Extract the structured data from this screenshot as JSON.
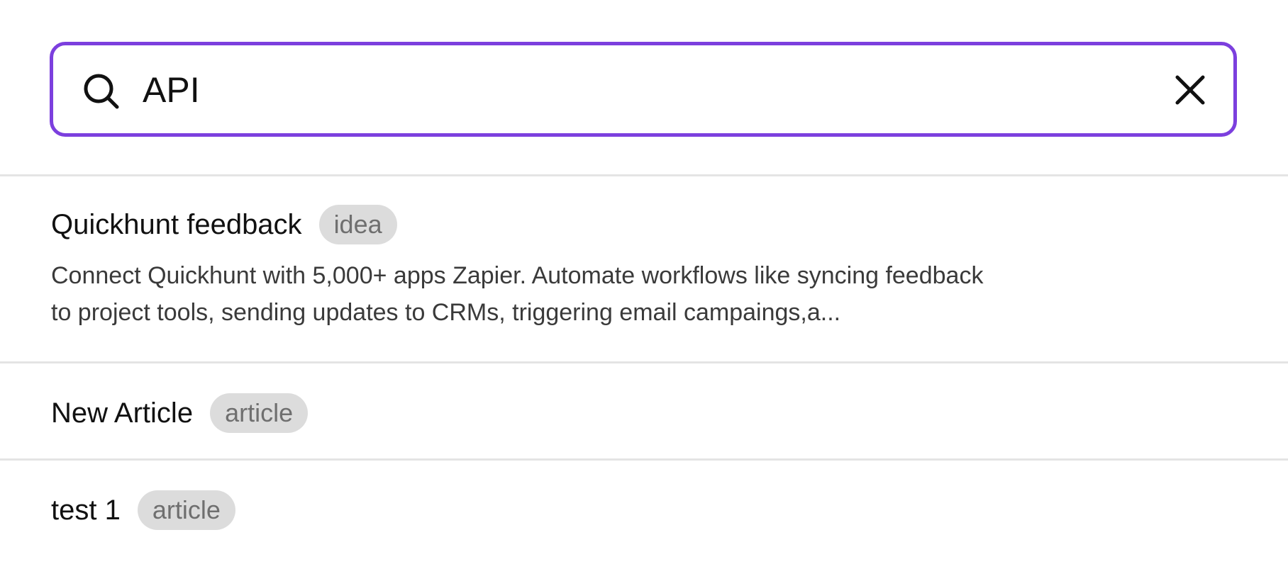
{
  "search": {
    "value": "API",
    "icon": "search-icon",
    "clear_icon": "close-icon",
    "accent_color": "#7c3fde"
  },
  "results": [
    {
      "title": "Quickhunt feedback",
      "badge": "idea",
      "description_line1": "Connect Quickhunt with 5,000+ apps Zapier. Automate workflows like syncing feedback",
      "description_line2": "to project tools, sending updates to CRMs, triggering email campaings,a..."
    },
    {
      "title": "New Article",
      "badge": "article"
    },
    {
      "title": "test 1",
      "badge": "article"
    }
  ]
}
